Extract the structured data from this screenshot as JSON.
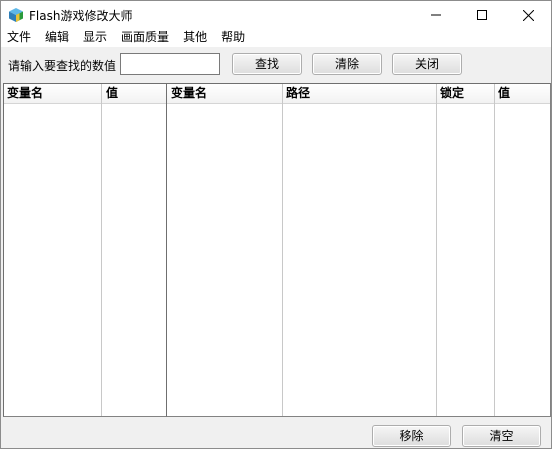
{
  "window": {
    "title": "Flash游戏修改大师",
    "minimize_glyph": "—",
    "maximize_glyph": "☐",
    "close_glyph": "✕",
    "app_icon": "cube-app-icon"
  },
  "menu": {
    "items": [
      "文件",
      "编辑",
      "显示",
      "画面质量",
      "其他",
      "帮助"
    ]
  },
  "toolbar": {
    "search_label": "请输入要查找的数值",
    "search_value": "",
    "find_label": "查找",
    "clear_label": "清除",
    "close_label": "关闭"
  },
  "left_table": {
    "columns": [
      "变量名",
      "值"
    ],
    "rows": []
  },
  "right_table": {
    "columns": [
      "变量名",
      "路径",
      "锁定",
      "值"
    ],
    "rows": []
  },
  "bottom": {
    "remove_label": "移除",
    "clear_all_label": "清空"
  }
}
